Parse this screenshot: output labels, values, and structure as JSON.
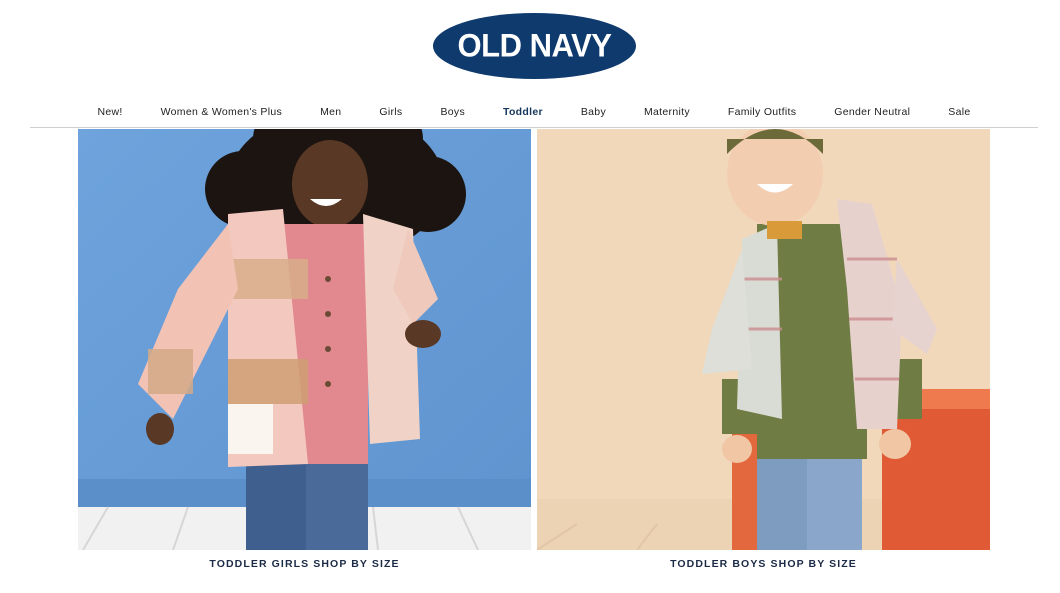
{
  "brand": {
    "logo_text": "OLD NAVY",
    "color": "#0f3a6e"
  },
  "nav": {
    "items": [
      {
        "label": "New!",
        "active": false
      },
      {
        "label": "Women & Women's Plus",
        "active": false
      },
      {
        "label": "Men",
        "active": false
      },
      {
        "label": "Girls",
        "active": false
      },
      {
        "label": "Boys",
        "active": false
      },
      {
        "label": "Toddler",
        "active": true
      },
      {
        "label": "Baby",
        "active": false
      },
      {
        "label": "Maternity",
        "active": false
      },
      {
        "label": "Family Outfits",
        "active": false
      },
      {
        "label": "Gender Neutral",
        "active": false
      },
      {
        "label": "Sale",
        "active": false
      }
    ]
  },
  "tiles": [
    {
      "caption": "TODDLER GIRLS SHOP BY SIZE"
    },
    {
      "caption": "TODDLER BOYS SHOP BY SIZE"
    }
  ],
  "colors": {
    "girls_background": "#6b9fd6",
    "boys_background": "#f1d7b8",
    "active_nav": "#14365d"
  }
}
